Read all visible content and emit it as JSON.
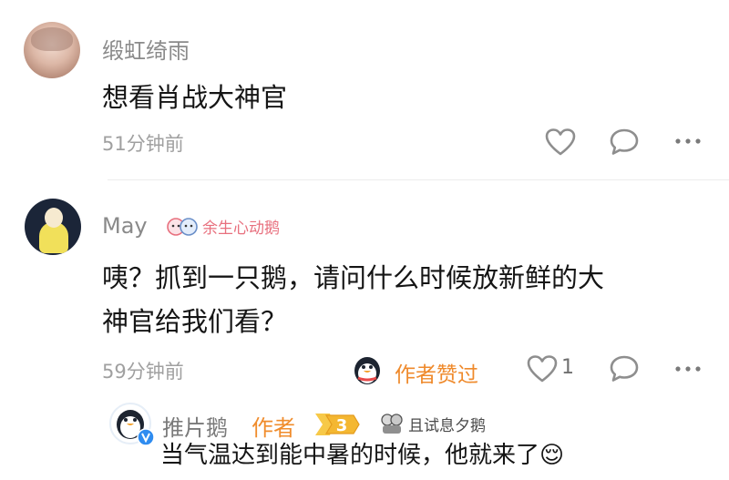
{
  "comment1": {
    "username": "缎虹绮雨",
    "text": "想看肖战大神官",
    "time": "51分钟前"
  },
  "comment2": {
    "username": "May",
    "tag": "余生心动鹅",
    "text_line1": "咦？抓到一只鹅，请问什么时候放新鲜的大",
    "text_line2": "神官给我们看？",
    "time": "59分钟前",
    "author_liked": "作者赞过",
    "like_count": "1"
  },
  "reply": {
    "username": "推片鹅",
    "author_badge": "作者",
    "level": "3",
    "tag": "且试息夕鹅",
    "text": "当气温达到能中暑的时候，他就来了",
    "emoji": "😌"
  },
  "colors": {
    "accent_orange": "#ef8a2c",
    "tag_pink": "#e8707e",
    "meta_gray": "#a0a0a0"
  },
  "icons": [
    "heart-icon",
    "comment-icon",
    "more-icon",
    "penguin-icon",
    "verified-icon",
    "level-badge-icon"
  ]
}
